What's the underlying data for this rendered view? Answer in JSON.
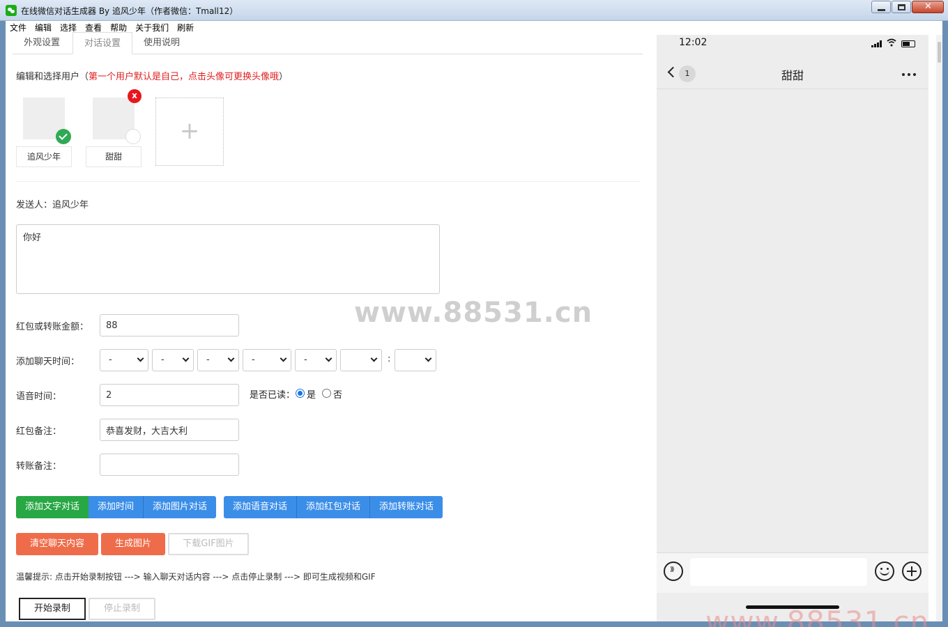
{
  "window": {
    "title": "在线微信对话生成器 By 追风少年（作者微信：Tmall12）"
  },
  "menu": [
    "文件",
    "编辑",
    "选择",
    "查看",
    "帮助",
    "关于我们",
    "刷新"
  ],
  "tabs": [
    "外观设置",
    "对话设置",
    "使用说明"
  ],
  "users_section": {
    "hint_prefix": "编辑和选择用户（",
    "hint_red": "第一个用户默认是自己，点击头像可更换头像哦",
    "hint_suffix": "）",
    "users": [
      {
        "name": "追风少年",
        "selected": true
      },
      {
        "name": "甜甜",
        "selected": false
      }
    ],
    "remove_glyph": "x",
    "add_glyph": "+"
  },
  "sender_line": "发送人：追风少年",
  "message": {
    "value": "你好"
  },
  "form": {
    "amount_label": "红包或转账金额：",
    "amount_value": "88",
    "time_label": "添加聊天时间：",
    "time_selects": [
      "-",
      "-",
      "-",
      "-",
      "-",
      "",
      ""
    ],
    "time_colon": ":",
    "voice_label": "语音时间：",
    "voice_value": "2",
    "read_label": "是否已读：",
    "read_yes": "是",
    "read_no": "否",
    "redpacket_note_label": "红包备注：",
    "redpacket_note_value": "恭喜发财，大吉大利",
    "transfer_note_label": "转账备注：",
    "transfer_note_value": ""
  },
  "buttons": {
    "add_text": "添加文字对话",
    "add_time": "添加时间",
    "add_image": "添加图片对话",
    "add_voice": "添加语音对话",
    "add_redpacket": "添加红包对话",
    "add_transfer": "添加转账对话",
    "clear": "清空聊天内容",
    "generate": "生成图片",
    "download_gif": "下载GIF图片",
    "start_record": "开始录制",
    "stop_record": "停止录制"
  },
  "tip": "温馨提示: 点击开始录制按钮 ---> 输入聊天对话内容 ---> 点击停止录制 ---> 即可生成视频和GIF",
  "watermark": "www.88531.cn",
  "phone": {
    "time": "12:02",
    "unread": "1",
    "chat_title": "甜甜"
  }
}
